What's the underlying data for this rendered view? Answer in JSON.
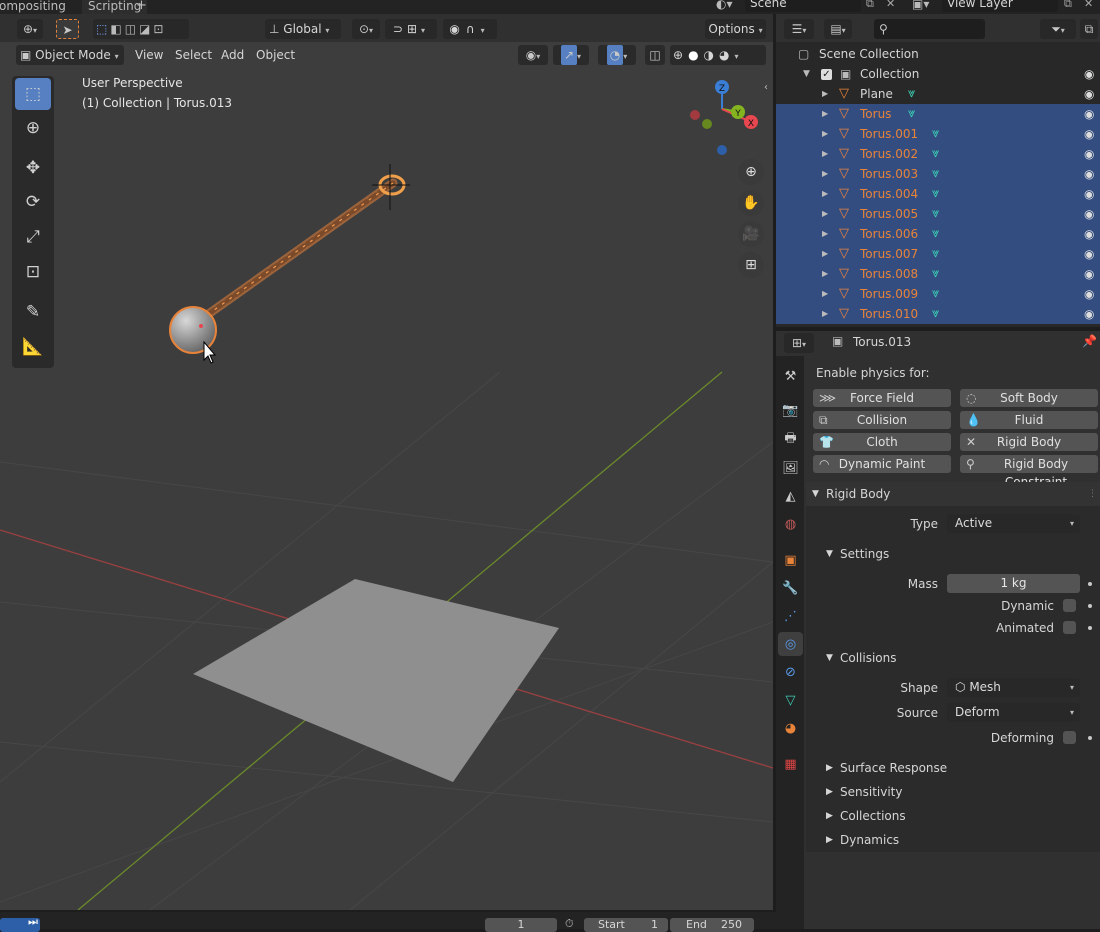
{
  "workspace_tabs": [
    "ompositing",
    "Scripting",
    "+"
  ],
  "scene": {
    "label": "Scene"
  },
  "view_layer": {
    "label": "View Layer"
  },
  "viewport": {
    "transform": "Global",
    "options": "Options",
    "mode": "Object Mode",
    "menus": [
      "View",
      "Select",
      "Add",
      "Object"
    ],
    "info_line1": "User Perspective",
    "info_line2": "(1) Collection | Torus.013",
    "gizmo": {
      "z": "Z",
      "y": "Y",
      "x": "X"
    }
  },
  "outliner": {
    "search_placeholder": "",
    "scene_collection": "Scene Collection",
    "collection": "Collection",
    "items": [
      {
        "name": "Plane",
        "selected": false
      },
      {
        "name": "Torus",
        "selected": true
      },
      {
        "name": "Torus.001",
        "selected": true
      },
      {
        "name": "Torus.002",
        "selected": true
      },
      {
        "name": "Torus.003",
        "selected": true
      },
      {
        "name": "Torus.004",
        "selected": true
      },
      {
        "name": "Torus.005",
        "selected": true
      },
      {
        "name": "Torus.006",
        "selected": true
      },
      {
        "name": "Torus.007",
        "selected": true
      },
      {
        "name": "Torus.008",
        "selected": true
      },
      {
        "name": "Torus.009",
        "selected": true
      },
      {
        "name": "Torus.010",
        "selected": true
      }
    ]
  },
  "properties": {
    "object_name": "Torus.013",
    "enable_physics": "Enable physics for:",
    "physics_buttons": {
      "force_field": "Force Field",
      "soft_body": "Soft Body",
      "collision": "Collision",
      "fluid": "Fluid",
      "cloth": "Cloth",
      "rigid_body": "Rigid Body",
      "dynamic_paint": "Dynamic Paint",
      "rigid_body_constraint": "Rigid Body Constraint"
    },
    "rigid_body_panel": "Rigid Body",
    "type_label": "Type",
    "type_value": "Active",
    "settings_panel": "Settings",
    "mass_label": "Mass",
    "mass_value": "1 kg",
    "dynamic_label": "Dynamic",
    "animated_label": "Animated",
    "collisions_panel": "Collisions",
    "shape_label": "Shape",
    "shape_value": "Mesh",
    "source_label": "Source",
    "source_value": "Deform",
    "deforming_label": "Deforming",
    "surface_response": "Surface Response",
    "sensitivity": "Sensitivity",
    "collections": "Collections",
    "dynamics": "Dynamics"
  },
  "timeline": {
    "current_frame": "1",
    "start_label": "Start",
    "start_value": "1",
    "end_label": "End",
    "end_value": "250"
  },
  "colors": {
    "selected_row": "#334d80",
    "orange_name": "#e8833a",
    "mesh_icon": "#3ccfb4",
    "active_tool": "#5680c2",
    "axis_x": "#e8474f",
    "axis_y": "#84b521",
    "axis_z": "#3b7ed6"
  }
}
